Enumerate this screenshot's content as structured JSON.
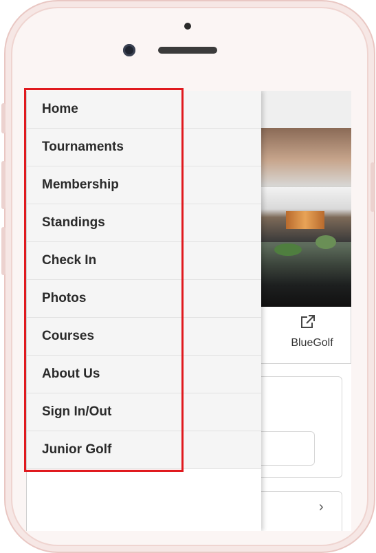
{
  "menu": {
    "items": [
      {
        "label": "Home"
      },
      {
        "label": "Tournaments"
      },
      {
        "label": "Membership"
      },
      {
        "label": "Standings"
      },
      {
        "label": "Check In"
      },
      {
        "label": "Photos"
      },
      {
        "label": "Courses"
      },
      {
        "label": "About Us"
      },
      {
        "label": "Sign In/Out"
      },
      {
        "label": "Junior Golf"
      }
    ]
  },
  "main": {
    "bluegolf_label": "BlueGolf",
    "bluegolf_icon": "external-link-icon",
    "card_icon": "chevron-right-icon"
  },
  "colors": {
    "highlight": "#e0191e",
    "menu_bg": "#f5f5f5",
    "phone_frame": "#e9c7c3"
  }
}
